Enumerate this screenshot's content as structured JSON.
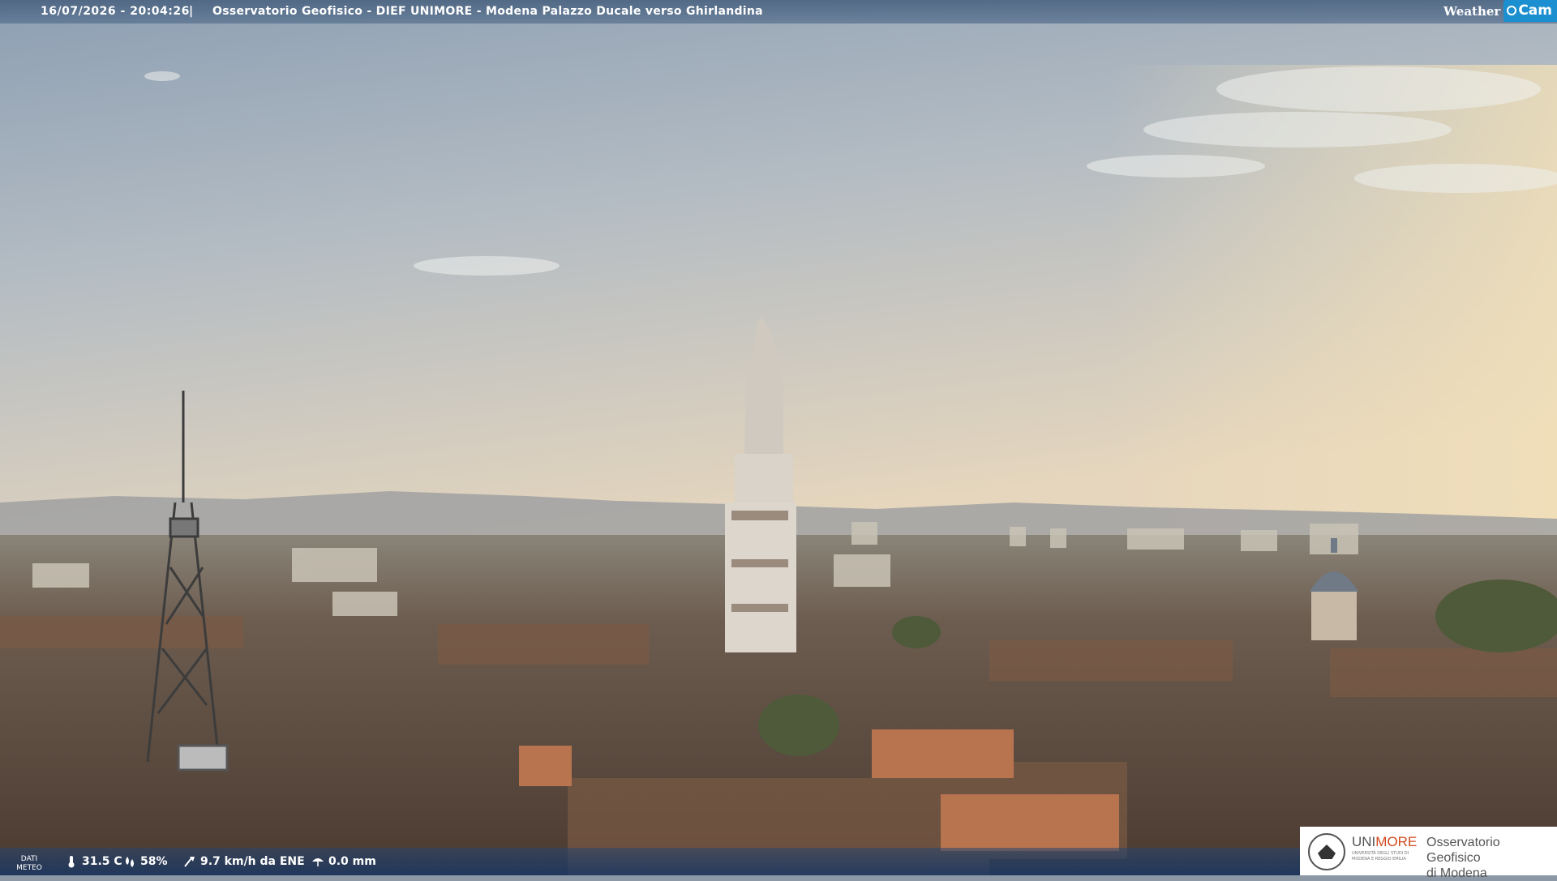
{
  "header": {
    "timestamp": "16/07/2026 - 20:04:26",
    "separator": "|",
    "title": "Osservatorio Geofisico - DIEF UNIMORE - Modena Palazzo Ducale verso Ghirlandina",
    "brand_weather": "Weather",
    "brand_cam": "Cam"
  },
  "footer": {
    "dati_label_1": "DATI",
    "dati_label_2": "METEO",
    "temperature": "31.5 C",
    "humidity": "58%",
    "wind": "9.7 km/h da ENE",
    "rain": "0.0 mm"
  },
  "logo": {
    "uni_part1": "UNI",
    "uni_part2": "MORE",
    "uni_sub": "UNIVERSITÀ DEGLI STUDI DI MODENA E REGGIO EMILIA",
    "observatory_line1": "Osservatorio Geofisico",
    "observatory_line2": "di Modena"
  },
  "colors": {
    "sky_top": "#8d9fb3",
    "sky_horizon": "#e6d6bd",
    "roofs": "#5e4a3d",
    "tower": "#d8d2c8",
    "accent_orange": "#d24a1d",
    "webcam_blue": "#1b8fd0"
  }
}
